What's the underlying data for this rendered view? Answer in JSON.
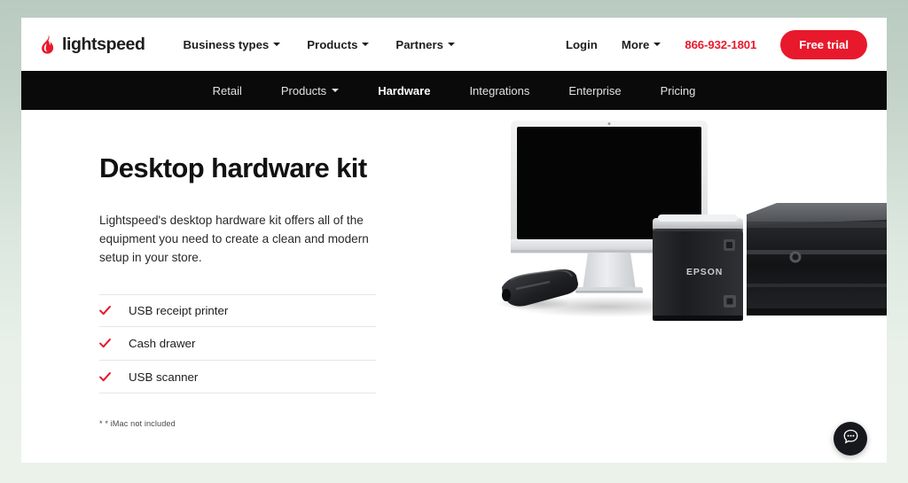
{
  "brand": {
    "name": "lightspeed",
    "logo_icon": "flame-icon",
    "accent_red": "#e8192c",
    "nav_black": "#0a0a0a"
  },
  "header": {
    "nav": [
      {
        "label": "Business types",
        "has_caret": true
      },
      {
        "label": "Products",
        "has_caret": true
      },
      {
        "label": "Partners",
        "has_caret": true
      }
    ],
    "login_label": "Login",
    "more_label": "More",
    "phone": "866-932-1801",
    "trial_label": "Free trial"
  },
  "subnav": {
    "items": [
      {
        "label": "Retail",
        "has_caret": false,
        "active": false
      },
      {
        "label": "Products",
        "has_caret": true,
        "active": false
      },
      {
        "label": "Hardware",
        "has_caret": false,
        "active": true
      },
      {
        "label": "Integrations",
        "has_caret": false,
        "active": false
      },
      {
        "label": "Enterprise",
        "has_caret": false,
        "active": false
      },
      {
        "label": "Pricing",
        "has_caret": false,
        "active": false
      }
    ]
  },
  "hero": {
    "title": "Desktop hardware kit",
    "body": "Lightspeed's desktop hardware kit offers all of the equipment you need to create a clean and modern setup in your store.",
    "features": [
      {
        "label": "USB receipt printer",
        "icon": "check-icon"
      },
      {
        "label": "Cash drawer",
        "icon": "check-icon"
      },
      {
        "label": "USB scanner",
        "icon": "check-icon"
      }
    ],
    "footnote": "* * iMac not included",
    "image_items": [
      "imac-monitor",
      "barcode-scanner",
      "epson-receipt-printer",
      "cash-drawer"
    ],
    "printer_brand": "EPSON"
  },
  "chat": {
    "icon": "chat-bubble-icon",
    "label": "Help"
  }
}
